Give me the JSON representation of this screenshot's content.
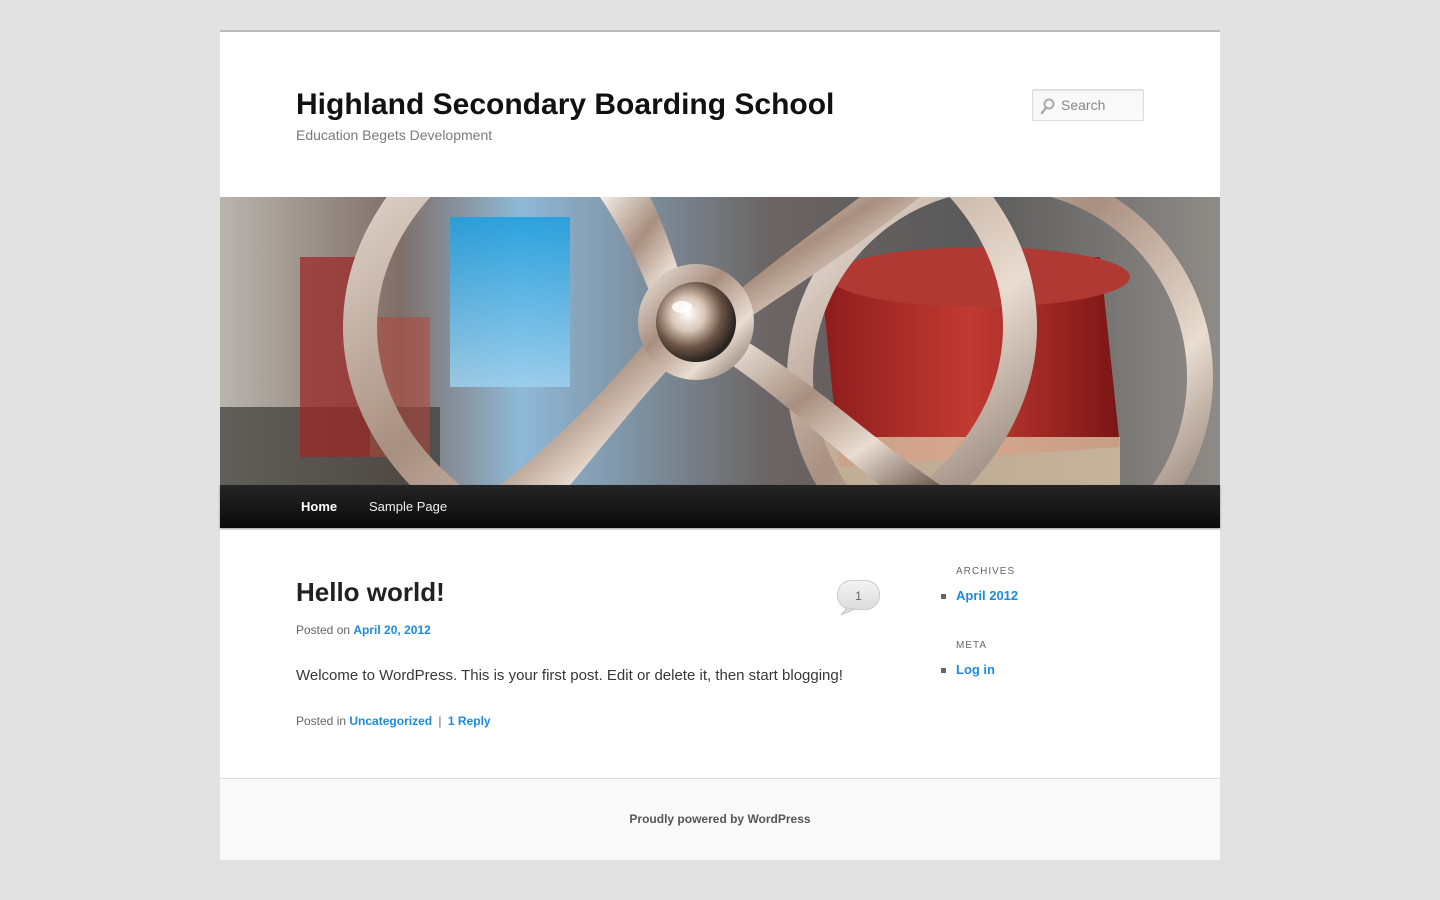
{
  "header": {
    "site_title": "Highland Secondary Boarding School",
    "site_description": "Education Begets Development",
    "search_placeholder": "Search"
  },
  "nav": {
    "items": [
      {
        "label": "Home",
        "active": true
      },
      {
        "label": "Sample Page",
        "active": false
      }
    ]
  },
  "post": {
    "title": "Hello world!",
    "comments_count": "1",
    "posted_on_label": "Posted on",
    "date": "April 20, 2012",
    "content": "Welcome to WordPress. This is your first post. Edit or delete it, then start blogging!",
    "posted_in_label": "Posted in",
    "category": "Uncategorized",
    "separator": "|",
    "reply_link": "1 Reply"
  },
  "sidebar": {
    "archives": {
      "title": "Archives",
      "items": [
        "April 2012"
      ]
    },
    "meta": {
      "title": "Meta",
      "items": [
        "Log in"
      ]
    }
  },
  "footer": {
    "generator": "Proudly powered by WordPress"
  },
  "colors": {
    "link": "#1b8be0",
    "nav_background": "#0a0a0a",
    "page_background": "#e2e2e2"
  },
  "icons": {
    "search": "search-icon",
    "comment_bubble": "comment-bubble-icon"
  }
}
